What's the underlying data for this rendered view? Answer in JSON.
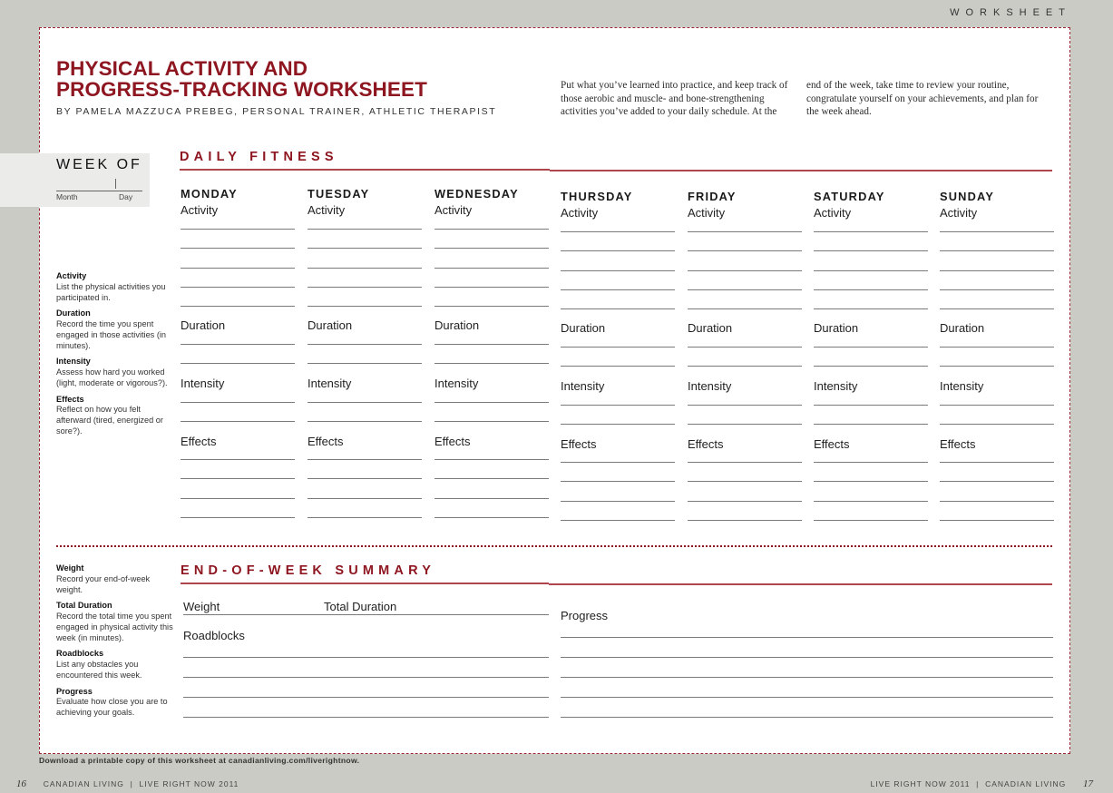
{
  "header": {
    "section_tag": "WORKSHEET",
    "title_line1": "PHYSICAL ACTIVITY AND",
    "title_line2": "PROGRESS-TRACKING WORKSHEET",
    "byline": "BY PAMELA MAZZUCA PREBEG, PERSONAL TRAINER, ATHLETIC THERAPIST",
    "intro_left": "Put what you’ve learned into practice, and keep track of those aerobic and muscle- and bone-strengthening activities you’ve added to your daily schedule. At the",
    "intro_right": "end of the week, take time to review your routine, congratulate yourself on your achievements, and plan for the week ahead."
  },
  "week_of": {
    "title": "WEEK OF",
    "month_label": "Month",
    "day_label": "Day"
  },
  "daily_fitness": {
    "heading": "DAILY FITNESS",
    "field_labels": {
      "activity": "Activity",
      "duration": "Duration",
      "intensity": "Intensity",
      "effects": "Effects"
    },
    "days": [
      "MONDAY",
      "TUESDAY",
      "WEDNESDAY",
      "THURSDAY",
      "FRIDAY",
      "SATURDAY",
      "SUNDAY"
    ],
    "line_counts": {
      "activity": 5,
      "duration": 2,
      "intensity": 2,
      "effects": 4
    }
  },
  "daily_legend": [
    {
      "term": "Activity",
      "desc": "List the physical activities you participated in."
    },
    {
      "term": "Duration",
      "desc": "Record the time you spent engaged in those activities (in minutes)."
    },
    {
      "term": "Intensity",
      "desc": "Assess how hard you worked (light, moderate or vigorous?)."
    },
    {
      "term": "Effects",
      "desc": "Reflect on how you felt afterward (tired, energized or sore?)."
    }
  ],
  "summary": {
    "heading": "END-OF-WEEK SUMMARY",
    "weight_label": "Weight",
    "total_duration_label": "Total Duration",
    "roadblocks_label": "Roadblocks",
    "progress_label": "Progress"
  },
  "summary_legend": [
    {
      "term": "Weight",
      "desc": "Record your end-of-week weight."
    },
    {
      "term": "Total Duration",
      "desc": "Record the total time you spent engaged in physical activity this week (in minutes)."
    },
    {
      "term": "Roadblocks",
      "desc": "List any obstacles you encountered this week."
    },
    {
      "term": "Progress",
      "desc": "Evaluate how close you are to achieving your goals."
    }
  ],
  "footer": {
    "download_note": "Download a printable copy of this worksheet at canadianliving.com/liverightnow.",
    "left_page_number": "16",
    "left_folio": "CANADIAN LIVING  |  LIVE RIGHT NOW 2011",
    "right_folio": "LIVE RIGHT NOW 2011  |  CANADIAN LIVING",
    "right_page_number": "17"
  },
  "colors": {
    "accent_red": "#8e1620",
    "page_background": "#cbcbc6",
    "week_of_box": "#ebebe9"
  }
}
